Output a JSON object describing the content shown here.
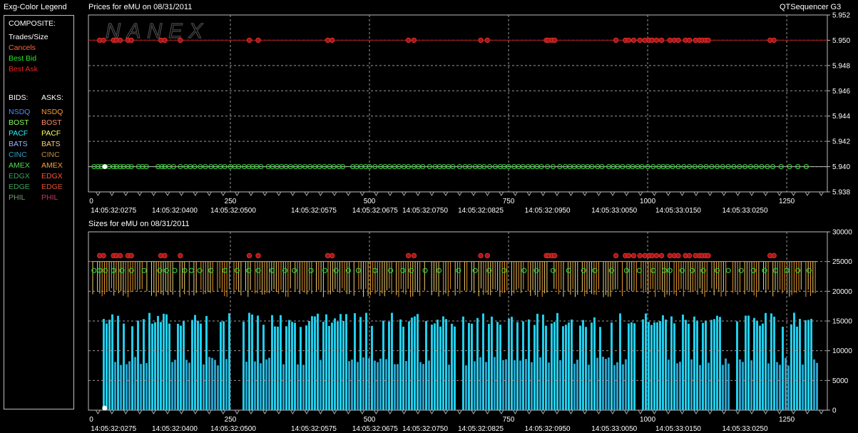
{
  "window": {
    "legend_title": "Exg-Color Legend",
    "app_name": "QTSequencer G3"
  },
  "legend": {
    "composite_label": "COMPOSITE:",
    "composite_items": [
      {
        "label": "Trades/Size",
        "color": "#ffffff"
      },
      {
        "label": "Cancels",
        "color": "#ff6a3d"
      },
      {
        "label": "Best Bid",
        "color": "#22ee22"
      },
      {
        "label": "Best Ask",
        "color": "#ee2222"
      }
    ],
    "bids_label": "BIDS:",
    "asks_label": "ASKS:",
    "exchanges": [
      {
        "bid": "NSDQ",
        "ask": "NSDQ",
        "bid_color": "#4a8cff",
        "ask_color": "#ff9a2e"
      },
      {
        "bid": "BOST",
        "ask": "BOST",
        "bid_color": "#8aff5a",
        "ask_color": "#ff8a6a"
      },
      {
        "bid": "PACF",
        "ask": "PACF",
        "bid_color": "#2ef2ff",
        "ask_color": "#ffff55"
      },
      {
        "bid": "BATS",
        "ask": "BATS",
        "bid_color": "#9ab8ff",
        "ask_color": "#ffd070"
      },
      {
        "bid": "CINC",
        "ask": "CINC",
        "bid_color": "#30a0c0",
        "ask_color": "#c09040"
      },
      {
        "bid": "AMEX",
        "ask": "AMEX",
        "bid_color": "#55dd55",
        "ask_color": "#ffa030"
      },
      {
        "bid": "EDGX",
        "ask": "EDGX",
        "bid_color": "#3aa060",
        "ask_color": "#ff5533"
      },
      {
        "bid": "EDGE",
        "ask": "EDGE",
        "bid_color": "#40a060",
        "ask_color": "#dd5030"
      },
      {
        "bid": "PHIL",
        "ask": "PHIL",
        "bid_color": "#70a070",
        "ask_color": "#cc3366"
      }
    ]
  },
  "chart_data": [
    {
      "type": "scatter",
      "title": "Prices for  eMU  on  08/31/2011",
      "watermark": "NANEX",
      "x_ticks": [
        0,
        250,
        500,
        750,
        1000,
        1250
      ],
      "xlim": [
        0,
        1305
      ],
      "ylim": [
        5.938,
        5.952
      ],
      "y_ticks": [
        "5.938",
        "5.940",
        "5.942",
        "5.944",
        "5.946",
        "5.948",
        "5.950",
        "5.952"
      ],
      "time_labels": [
        "14:05:32:0275",
        "14:05:32:0400",
        "14:05:32:0500",
        "14:05:32:0575",
        "14:05:32:0675",
        "14:05:32:0750",
        "14:05:32:0825",
        "14:05:32:0950",
        "14:05:33:0050",
        "14:05:33:0150",
        "14:05:33:0250"
      ],
      "time_label_x": [
        40,
        150,
        255,
        400,
        510,
        600,
        700,
        820,
        940,
        1055,
        1175
      ],
      "grid": true,
      "series": [
        {
          "name": "Best Ask",
          "color": "#cc2222",
          "price": 5.95,
          "x": [
            15,
            22,
            40,
            45,
            52,
            66,
            72,
            125,
            132,
            160,
            284,
            300,
            425,
            433,
            570,
            580,
            700,
            712,
            818,
            822,
            828,
            833,
            943,
            960,
            966,
            975,
            986,
            995,
            1003,
            1008,
            1016,
            1025,
            1040,
            1048,
            1055,
            1068,
            1075,
            1086,
            1093,
            1098,
            1104,
            1109,
            1220,
            1227
          ]
        },
        {
          "name": "Best Bid",
          "color": "#33cc33",
          "price": 5.94,
          "x": [
            5,
            12,
            18,
            25,
            32,
            40,
            45,
            52,
            58,
            66,
            72,
            85,
            92,
            99,
            120,
            127,
            132,
            140,
            148,
            160,
            170,
            178,
            186,
            196,
            205,
            215,
            223,
            232,
            240,
            250,
            258,
            265,
            275,
            283,
            290,
            297,
            305,
            318,
            326,
            334,
            342,
            350,
            358,
            367,
            375,
            384,
            393,
            402,
            410,
            419,
            428,
            436,
            445,
            452,
            470,
            477,
            485,
            493,
            500,
            510,
            520,
            528,
            536,
            545,
            553,
            562,
            570,
            580,
            588,
            596,
            608,
            618,
            626,
            634,
            642,
            650,
            662,
            672,
            680,
            690,
            698,
            706,
            716,
            726,
            735,
            742,
            750,
            760,
            768,
            776,
            785,
            793,
            801,
            809,
            820,
            830,
            842,
            852,
            860,
            868,
            876,
            884,
            892,
            900,
            910,
            918,
            930,
            938,
            946,
            955,
            965,
            973,
            982,
            990,
            1000,
            1010,
            1020,
            1028,
            1036,
            1045,
            1055,
            1065,
            1075,
            1085,
            1095,
            1105,
            1115,
            1125,
            1135,
            1145,
            1155,
            1165,
            1175,
            1185,
            1195,
            1205,
            1215,
            1225,
            1240,
            1255,
            1270,
            1285
          ]
        },
        {
          "name": "Trades/Size",
          "color": "#ffffff",
          "price": 5.94,
          "x": [
            24
          ]
        }
      ]
    },
    {
      "type": "bar",
      "title": "Sizes for  eMU  on  08/31/2011",
      "x_ticks": [
        0,
        250,
        500,
        750,
        1000,
        1250
      ],
      "xlim": [
        0,
        1305
      ],
      "ylim": [
        0,
        30000
      ],
      "y_ticks": [
        "0",
        "5000",
        "10000",
        "15000",
        "20000",
        "25000",
        "30000"
      ],
      "grid": true,
      "series": [
        {
          "name": "Best Ask",
          "color": "#cc2222",
          "size": 26000,
          "x": [
            15,
            22,
            40,
            45,
            52,
            66,
            72,
            125,
            132,
            160,
            284,
            300,
            425,
            433,
            570,
            580,
            700,
            712,
            818,
            822,
            828,
            833,
            943,
            960,
            966,
            975,
            986,
            995,
            1003,
            1008,
            1016,
            1025,
            1040,
            1048,
            1055,
            1068,
            1075,
            1086,
            1093,
            1098,
            1104,
            1109,
            1220,
            1227
          ]
        },
        {
          "name": "Best Bid",
          "color": "#33cc33",
          "size": 23500,
          "x": [
            5,
            15,
            25,
            40,
            55,
            72,
            95,
            123,
            135,
            150,
            168,
            180,
            195,
            215,
            240,
            262,
            283,
            300,
            325,
            348,
            365,
            395,
            420,
            440,
            462,
            480,
            510,
            538,
            560,
            575,
            600,
            625,
            660,
            690,
            715,
            742,
            778,
            800,
            830,
            858,
            885,
            905,
            935,
            962,
            985,
            1010,
            1030,
            1040,
            1062,
            1080,
            1100,
            1125,
            1145,
            1168,
            1190,
            1210,
            1230,
            1250,
            1270,
            1290
          ]
        }
      ]
    }
  ]
}
